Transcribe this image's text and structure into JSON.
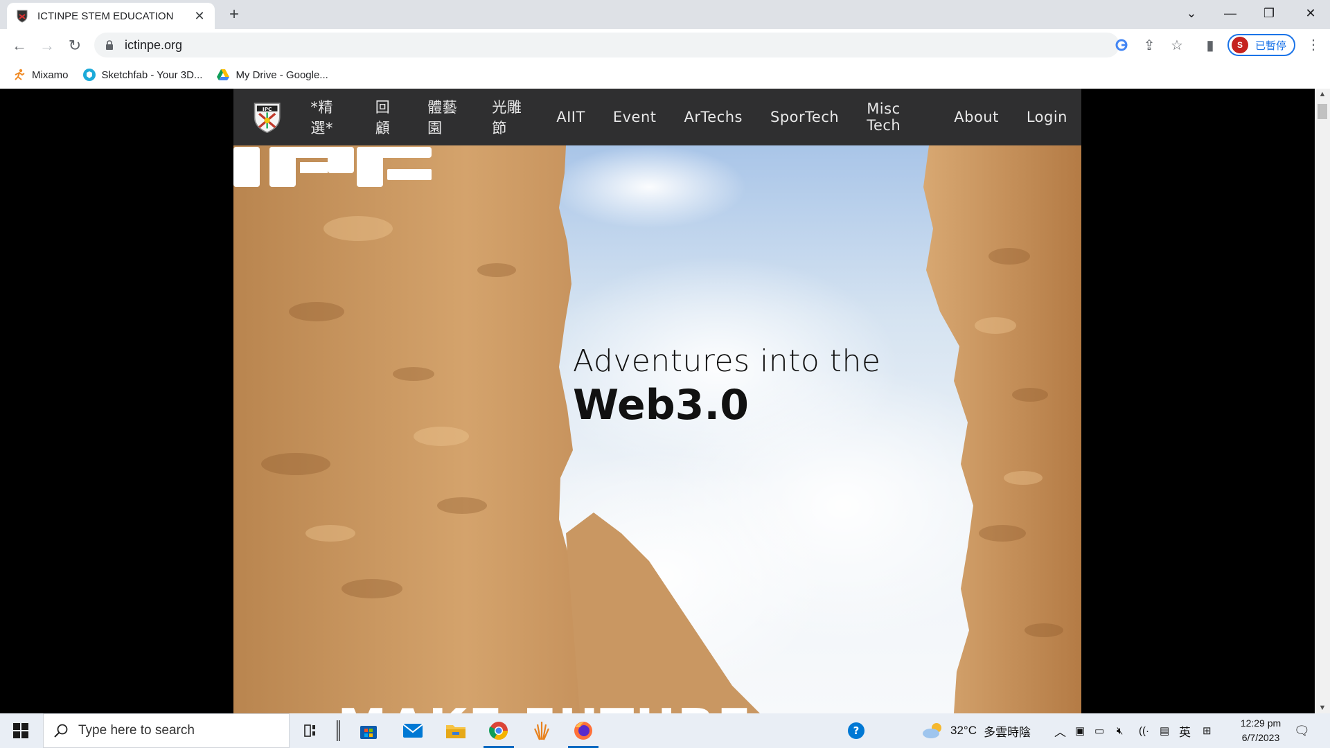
{
  "browser": {
    "tab": {
      "title": "ICTINPE STEM EDUCATION"
    },
    "url": "ictinpe.org",
    "profile_label": "已暫停",
    "profile_initial": "S",
    "bookmarks": [
      {
        "label": "Mixamo",
        "icon": "mixamo-icon"
      },
      {
        "label": "Sketchfab - Your 3D...",
        "icon": "sketchfab-icon"
      },
      {
        "label": "My Drive - Google...",
        "icon": "google-drive-icon"
      }
    ]
  },
  "site": {
    "nav": [
      "*精選*",
      "回顧",
      "體藝園",
      "光雕節",
      "AIIT",
      "Event",
      "ArTechs",
      "SporTech",
      "Misc Tech",
      "About",
      "Login"
    ],
    "hero": {
      "line1": "Adventures into the",
      "line2": "Web3.0",
      "bottom_text": "MAKE FUTURE"
    }
  },
  "taskbar": {
    "search_placeholder": "Type here to search",
    "weather_temp": "32°C",
    "weather_desc": "多雲時陰",
    "ime": "英",
    "time": "12:29 pm",
    "date": "6/7/2023"
  },
  "colors": {
    "site_nav_bg": "#2f2f30",
    "chrome_tabstrip": "#dee1e6",
    "accent": "#1a73e8"
  }
}
